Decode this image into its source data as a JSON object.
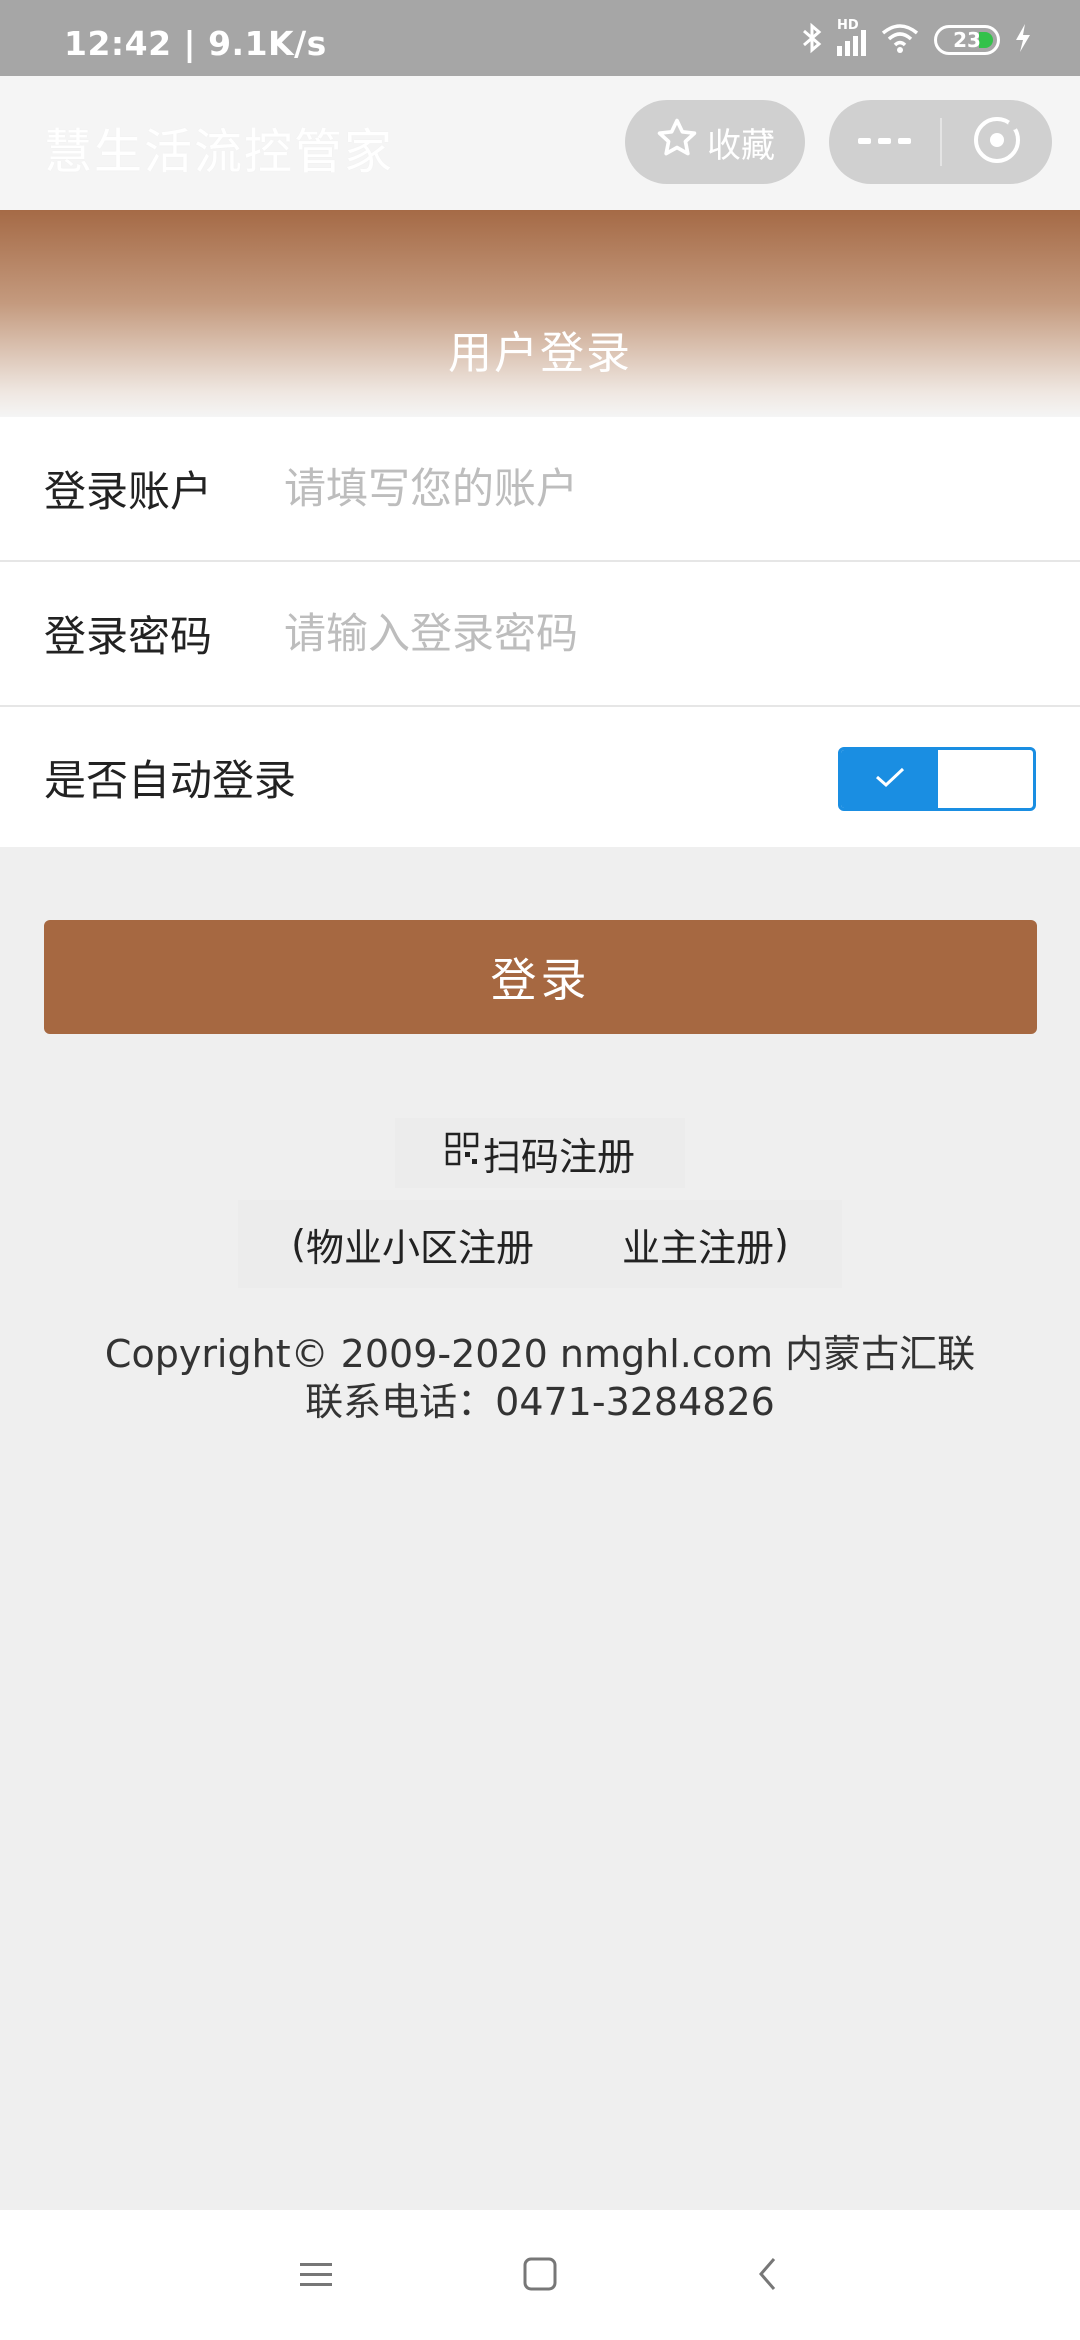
{
  "status_bar": {
    "time_speed": "12:42 | 9.1K/s",
    "network": "HD",
    "battery": "23"
  },
  "title_bar": {
    "app_title": "慧生活流控管家",
    "favorite_label": "收藏"
  },
  "banner": {
    "title": "用户登录"
  },
  "form": {
    "account_label": "登录账户",
    "account_placeholder": "请填写您的账户",
    "account_value": "",
    "password_label": "登录密码",
    "password_placeholder": "请输入登录密码",
    "password_value": "",
    "auto_login_label": "是否自动登录",
    "auto_login_enabled": true
  },
  "actions": {
    "login_label": "登录",
    "scan_register_label": "扫码注册",
    "open_paren": "(",
    "property_register_label": "物业小区注册",
    "owner_register_label": "业主注册",
    "close_paren": ")"
  },
  "footer": {
    "copyright": "Copyright© 2009-2020 nmghl.com 内蒙古汇联",
    "phone": "联系电话：0471-3284826"
  },
  "colors": {
    "accent_brown": "#a66841",
    "switch_blue": "#1a8ee2",
    "background": "#efefef"
  },
  "icons": [
    "bluetooth-icon",
    "signal-icon",
    "wifi-icon",
    "battery-icon",
    "charging-icon",
    "star-icon",
    "more-icon",
    "close-circle-icon",
    "qr-icon",
    "check-icon",
    "menu-icon",
    "home-icon",
    "back-icon"
  ]
}
